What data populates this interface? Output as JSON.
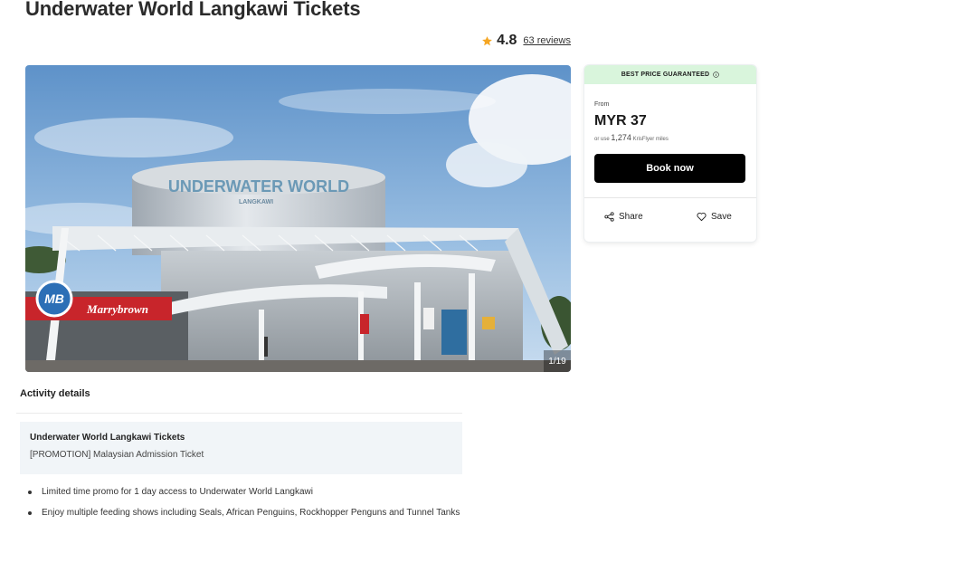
{
  "page": {
    "title": "Underwater World Langkawi Tickets"
  },
  "rating": {
    "score": "4.8",
    "reviews": "63 reviews",
    "star_color": "#f5a623",
    "icon": "star-icon"
  },
  "gallery": {
    "sign_text": "UNDERWATER WORLD",
    "sign_subtext": "LANGKAWI",
    "store_sign": "Marrybrown",
    "store_logo": "MB",
    "counter": "1/19"
  },
  "booking": {
    "banner": "BEST PRICE GUARANTEED",
    "banner_color": "#d9f5dc",
    "banner_icon": "info-icon",
    "from_label": "From",
    "price": "MYR 37",
    "miles_prefix": "or use",
    "miles_value": "1,274",
    "miles_suffix": "KrisFlyer miles",
    "book_label": "Book now",
    "share_label": "Share",
    "share_icon": "share-icon",
    "save_label": "Save",
    "save_icon": "heart-icon"
  },
  "details": {
    "heading": "Activity details",
    "package_name": "Underwater World Langkawi Tickets",
    "package_option": "[PROMOTION] Malaysian Admission Ticket",
    "bullets": [
      "Limited time promo for 1 day access to Underwater World Langkawi",
      "Enjoy multiple feeding shows including Seals, African Penguins, Rockhopper Penguns and Tunnel Tanks"
    ]
  }
}
